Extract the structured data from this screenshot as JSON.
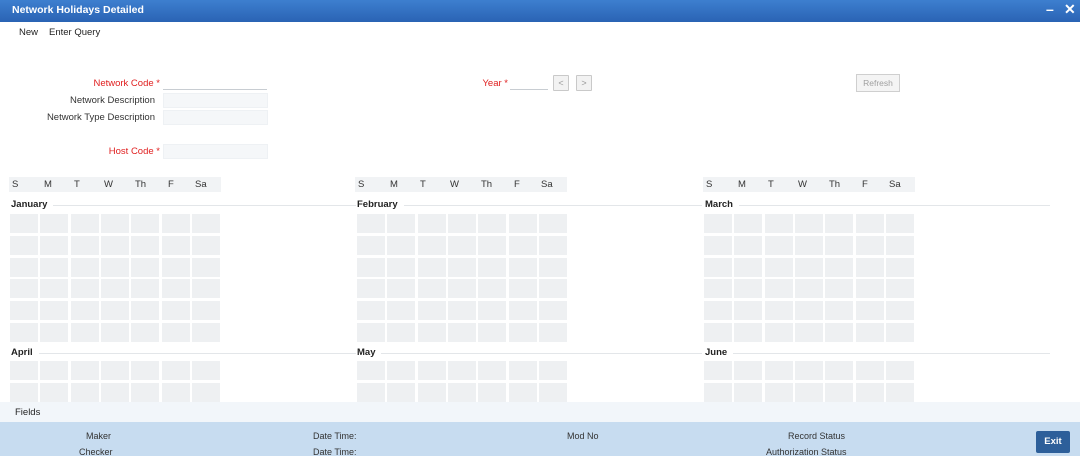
{
  "window": {
    "title": "Network Holidays Detailed",
    "minimize": "–",
    "close": "✕"
  },
  "menu": {
    "new": "New",
    "enter_query": "Enter Query"
  },
  "form": {
    "network_code_label": "Network Code",
    "network_desc_label": "Network Description",
    "network_type_desc_label": "Network Type Description",
    "host_code_label": "Host Code",
    "year_label": "Year",
    "required_mark": "*",
    "prev": "<",
    "next": ">",
    "refresh": "Refresh"
  },
  "days": [
    "S",
    "M",
    "T",
    "W",
    "Th",
    "F",
    "Sa"
  ],
  "months": [
    "January",
    "February",
    "March",
    "April",
    "May",
    "June"
  ],
  "fields_tab": "Fields",
  "footer": {
    "maker": "Maker",
    "checker": "Checker",
    "date_time_1": "Date Time:",
    "date_time_2": "Date Time:",
    "mod_no": "Mod No",
    "record_status": "Record Status",
    "authorization_status": "Authorization Status",
    "exit": "Exit"
  }
}
